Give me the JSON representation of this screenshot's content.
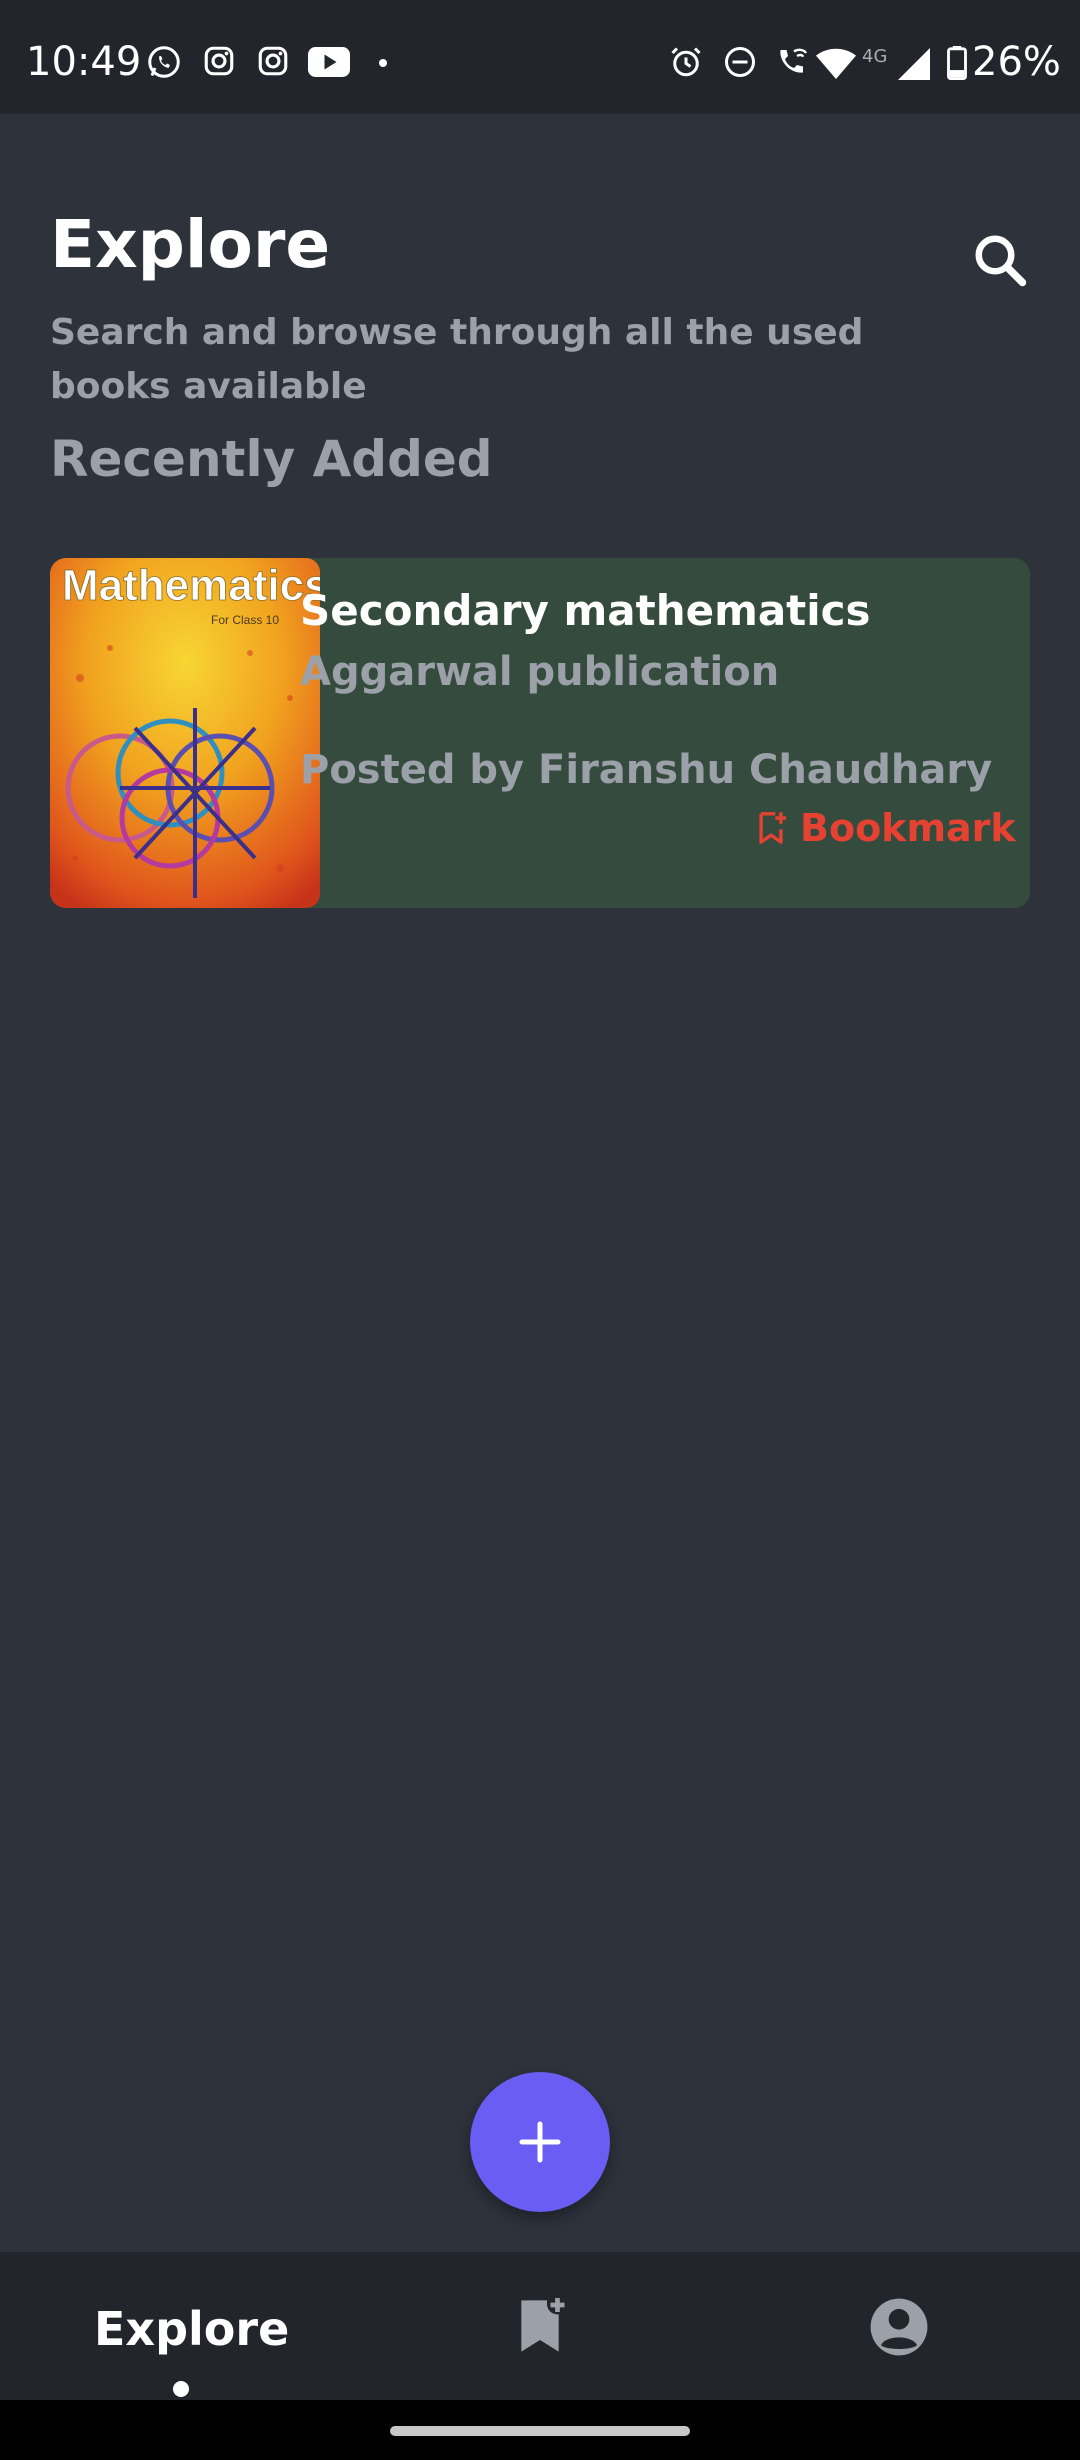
{
  "status_bar": {
    "time": "10:49",
    "network": "4G",
    "battery": "26%",
    "icons": [
      "whatsapp-icon",
      "instagram-icon",
      "instagram-icon",
      "youtube-icon",
      "dot-icon",
      "alarm-icon",
      "dnd-icon",
      "wifi-call-icon",
      "wifi-icon",
      "signal-icon",
      "battery-icon"
    ]
  },
  "header": {
    "title": "Explore",
    "subtitle": "Search and browse through all the used books available",
    "section": "Recently Added"
  },
  "books": [
    {
      "cover_title": "Mathematics",
      "cover_subtitle": "For Class 10",
      "title": "Secondary mathematics",
      "publisher": "Aggarwal publication",
      "posted_by": "Posted by Firanshu Chaudhary",
      "bookmark_label": "Bookmark"
    }
  ],
  "bottom_nav": {
    "explore": "Explore",
    "items": [
      "explore",
      "bookmarks-icon",
      "profile-icon"
    ]
  },
  "colors": {
    "background": "#2d323b",
    "card": "#344b3e",
    "accent": "#6a5df3",
    "bookmark": "#e64232",
    "muted_text": "#9ca1a9"
  }
}
